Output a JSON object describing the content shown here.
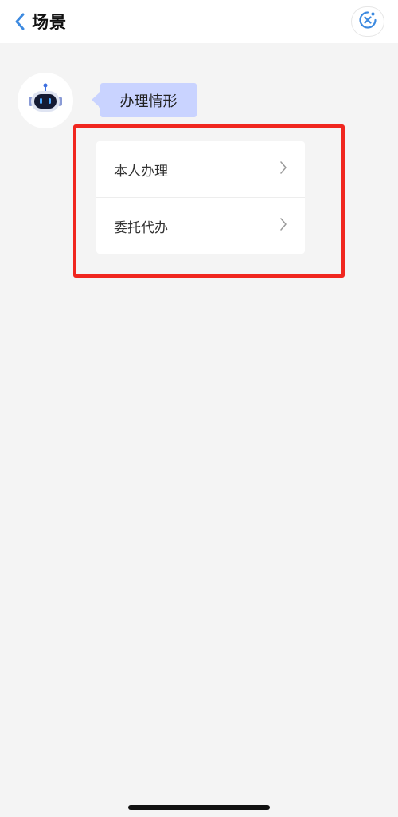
{
  "header": {
    "title": "场景",
    "back_icon": "chevron-left-icon",
    "close_icon": "close-circle-icon",
    "accent_color": "#3d8ae0"
  },
  "chat": {
    "avatar_icon": "robot-icon",
    "bubble_text": "办理情形",
    "bubble_color": "#c9d3ff"
  },
  "options": [
    {
      "label": "本人办理",
      "icon": "chevron-right-icon"
    },
    {
      "label": "委托代办",
      "icon": "chevron-right-icon"
    }
  ],
  "highlight_color": "#f0261f"
}
